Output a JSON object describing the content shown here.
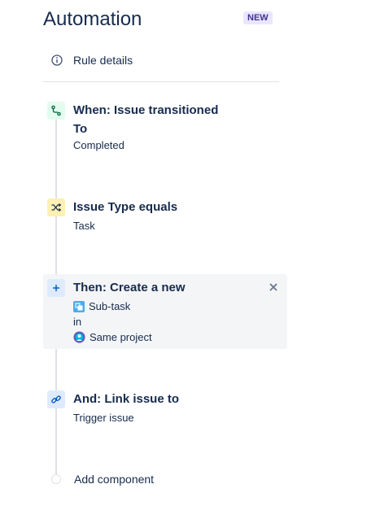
{
  "header": {
    "title": "Automation",
    "badge": "NEW"
  },
  "rule_details": {
    "label": "Rule details",
    "icon": "info-icon"
  },
  "steps": [
    {
      "icon": "branch-icon",
      "title_line1": "When: Issue transitioned",
      "title_line2": "To",
      "detail": "Completed",
      "color": "#e3fcef"
    },
    {
      "icon": "shuffle-icon",
      "title_line1": "Issue Type equals",
      "detail": "Task",
      "color": "#fff0b3"
    },
    {
      "icon": "plus-icon",
      "title_line1": "Then: Create a new",
      "detail_issue_type": "Sub-task",
      "detail_in": "in",
      "detail_project": "Same project",
      "color": "#deebff"
    },
    {
      "icon": "link-icon",
      "title_line1": "And: Link issue to",
      "detail": "Trigger issue",
      "color": "#deebff"
    }
  ],
  "add_component": {
    "label": "Add component"
  }
}
